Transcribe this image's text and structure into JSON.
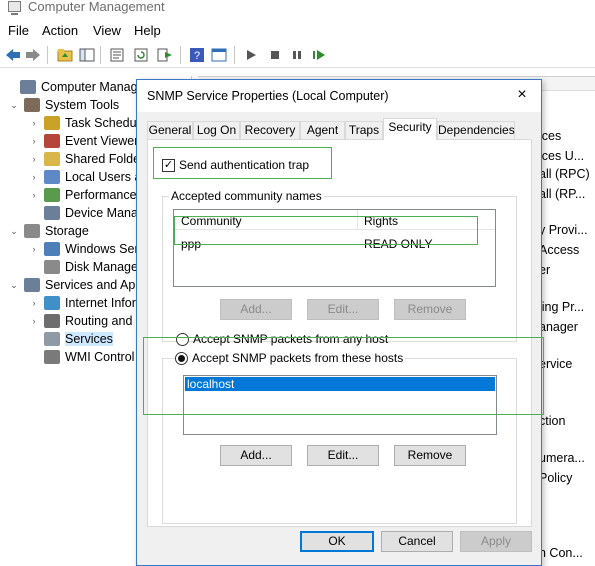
{
  "window": {
    "title": "Computer Management",
    "menu": [
      "File",
      "Action",
      "View",
      "Help"
    ]
  },
  "toolbar": {
    "icons": [
      "back-icon",
      "forward-icon",
      "folder-up-icon",
      "show-hide-tree-icon",
      "properties-icon",
      "refresh-icon",
      "export-icon",
      "help-icon",
      "console-icon",
      "play-icon",
      "stop-icon",
      "pause-icon",
      "resume-icon"
    ]
  },
  "tree": {
    "items": [
      {
        "label": "Computer Management",
        "level": 0
      },
      {
        "label": "System Tools",
        "level": 1
      },
      {
        "label": "Task Schedule",
        "level": 2
      },
      {
        "label": "Event Viewer",
        "level": 2
      },
      {
        "label": "Shared Folder",
        "level": 2
      },
      {
        "label": "Local Users ar",
        "level": 2
      },
      {
        "label": "Performance",
        "level": 2
      },
      {
        "label": "Device Manag",
        "level": 2
      },
      {
        "label": "Storage",
        "level": 1
      },
      {
        "label": "Windows Serv",
        "level": 2
      },
      {
        "label": "Disk Manager",
        "level": 2
      },
      {
        "label": "Services and App",
        "level": 1
      },
      {
        "label": "Internet Infor",
        "level": 2
      },
      {
        "label": "Routing and I",
        "level": 2
      },
      {
        "label": "Services",
        "level": 2
      },
      {
        "label": "WMI Control",
        "level": 2
      }
    ]
  },
  "right_pane": {
    "visible_fragments": [
      "ices",
      "ices U...",
      "all (RPC)",
      "all (RP...",
      "y Provi...",
      "Access",
      "er",
      "ling Pr...",
      "anager",
      "ervice",
      "ction",
      "umera...",
      "Policy",
      "n Con..."
    ]
  },
  "dialog": {
    "title": "SNMP Service Properties (Local Computer)",
    "close": "×",
    "tabs": [
      "General",
      "Log On",
      "Recovery",
      "Agent",
      "Traps",
      "Security",
      "Dependencies"
    ],
    "active_tab": "Security",
    "send_auth_trap": {
      "label": "Send authentication trap",
      "checked": true,
      "mark": "✓"
    },
    "community": {
      "group_label": "Accepted community names",
      "columns": [
        "Community",
        "Rights"
      ],
      "rows": [
        {
          "community": "ppp",
          "rights": "READ ONLY"
        }
      ],
      "buttons": [
        "Add...",
        "Edit...",
        "Remove"
      ]
    },
    "accept_any": {
      "label": "Accept SNMP packets from any host",
      "selected": false
    },
    "accept_these": {
      "label": "Accept SNMP packets from these hosts",
      "selected": true,
      "hosts": [
        "localhost"
      ],
      "buttons": [
        "Add...",
        "Edit...",
        "Remove"
      ]
    },
    "footer": {
      "ok": "OK",
      "cancel": "Cancel",
      "apply": "Apply"
    }
  },
  "colors": {
    "accent": "#0078d7",
    "highlight": "#4caf50",
    "selection": "#0078d7"
  }
}
